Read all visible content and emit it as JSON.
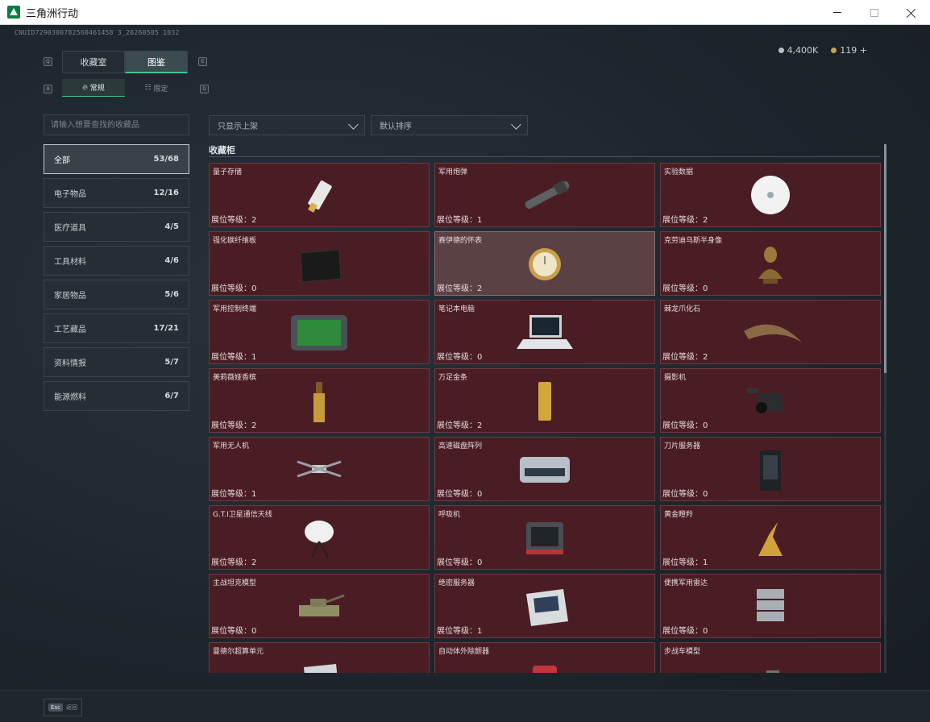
{
  "window": {
    "title": "三角洲行动"
  },
  "watermark": "CNUID7290300782560461458 3_20260505 1032",
  "currency": [
    {
      "icon": "silver-coin-icon",
      "value": "4,400K"
    },
    {
      "icon": "gold-coin-icon",
      "value": "119 +"
    }
  ],
  "keys": {
    "q": "Q",
    "e": "E",
    "a": "A",
    "d": "D"
  },
  "tabs": [
    {
      "label": "收藏室",
      "active": false
    },
    {
      "label": "图鉴",
      "active": true
    }
  ],
  "subtabs": [
    {
      "label": "常规",
      "icon": "flame-icon",
      "active": true
    },
    {
      "label": "限定",
      "icon": "gift-icon",
      "active": false
    }
  ],
  "search": {
    "placeholder": "请输入想要查找的收藏品"
  },
  "categories": [
    {
      "label": "全部",
      "count": "53/68",
      "active": true
    },
    {
      "label": "电子物品",
      "count": "12/16"
    },
    {
      "label": "医疗道具",
      "count": "4/5"
    },
    {
      "label": "工具材料",
      "count": "4/6"
    },
    {
      "label": "家居物品",
      "count": "5/6"
    },
    {
      "label": "工艺藏品",
      "count": "17/21"
    },
    {
      "label": "资料情报",
      "count": "5/7"
    },
    {
      "label": "能源燃料",
      "count": "6/7"
    }
  ],
  "filters": {
    "shelf": "只显示上架",
    "sort": "默认排序"
  },
  "section_title": "收藏柜",
  "level_prefix": "展位等级：",
  "items": [
    {
      "name": "量子存储",
      "level": "2",
      "icon": "usb-drive-icon"
    },
    {
      "name": "军用炮弹",
      "level": "1",
      "icon": "artillery-shell-icon"
    },
    {
      "name": "实验数据",
      "level": "2",
      "icon": "data-disc-icon"
    },
    {
      "name": "强化碳纤维板",
      "level": "0",
      "icon": "carbon-plate-icon"
    },
    {
      "name": "赛伊德的怀表",
      "level": "2",
      "icon": "pocket-watch-icon",
      "highlight": true
    },
    {
      "name": "克劳迪乌斯半身像",
      "level": "0",
      "icon": "bust-statue-icon"
    },
    {
      "name": "军用控制终端",
      "level": "1",
      "icon": "control-terminal-icon"
    },
    {
      "name": "笔记本电脑",
      "level": "0",
      "icon": "laptop-icon"
    },
    {
      "name": "棘龙爪化石",
      "level": "2",
      "icon": "claw-fossil-icon"
    },
    {
      "name": "美莉薇娅香槟",
      "level": "2",
      "icon": "champagne-bottle-icon"
    },
    {
      "name": "万足金条",
      "level": "2",
      "icon": "gold-bar-icon"
    },
    {
      "name": "摄影机",
      "level": "0",
      "icon": "video-camera-icon"
    },
    {
      "name": "军用无人机",
      "level": "1",
      "icon": "drone-icon"
    },
    {
      "name": "高速磁盘阵列",
      "level": "0",
      "icon": "disk-array-icon"
    },
    {
      "name": "刀片服务器",
      "level": "0",
      "icon": "blade-server-icon"
    },
    {
      "name": "G.T.I卫星通信天线",
      "level": "2",
      "icon": "satellite-dish-icon"
    },
    {
      "name": "呼吸机",
      "level": "0",
      "icon": "ventilator-icon"
    },
    {
      "name": "黄金瞪羚",
      "level": "1",
      "icon": "golden-gazelle-icon"
    },
    {
      "name": "主战坦克模型",
      "level": "0",
      "icon": "tank-model-icon"
    },
    {
      "name": "绝密服务器",
      "level": "1",
      "icon": "secret-server-icon"
    },
    {
      "name": "便携军用雷达",
      "level": "0",
      "icon": "portable-radar-icon"
    },
    {
      "name": "曼德尔超算单元",
      "level": "",
      "icon": "supercomputer-unit-icon"
    },
    {
      "name": "自动体外除颤器",
      "level": "",
      "icon": "defibrillator-icon"
    },
    {
      "name": "步战车模型",
      "level": "",
      "icon": "ifv-model-icon"
    }
  ],
  "footer": {
    "esc_key": "Esc",
    "back_label": "返回"
  },
  "colors": {
    "card_bg": "#4a1d24",
    "accent": "#43c58d",
    "highlight_card": "#5b4044"
  }
}
